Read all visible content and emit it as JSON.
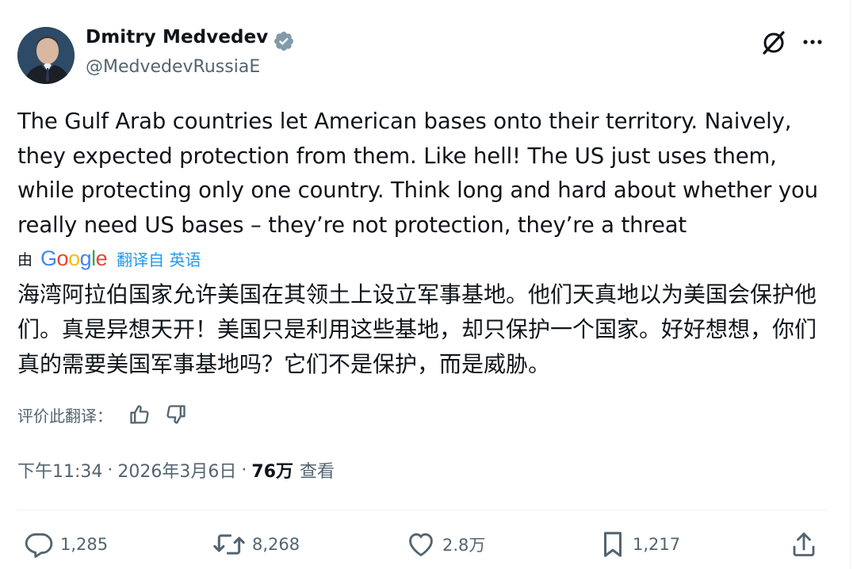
{
  "author": {
    "display_name": "Dmitry Medvedev",
    "handle": "@MedvedevRussiaE",
    "verified_badge": "verified-gear-badge",
    "avatar_icon": "avatar-portrait"
  },
  "header_icons": {
    "grok": "grok-icon",
    "more": "more-dots-icon"
  },
  "tweet": {
    "text": "The Gulf Arab countries let American bases onto their territory. Naively, they expected protection from them. Like hell! The US just uses them, while protecting only one country. Think long and hard about whether you really need US bases – they’re not protection, they’re a threat"
  },
  "translation": {
    "by_label": "由",
    "provider": "Google",
    "link_label": "翻译自 英语",
    "text": "海湾阿拉伯国家允许美国在其领土上设立军事基地。他们天真地以为美国会保护他们。真是异想天开！美国只是利用这些基地，却只保护一个国家。好好想想，你们真的需要美国军事基地吗？它们不是保护，而是威胁。",
    "rate_label": "评价此翻译："
  },
  "meta": {
    "time": "下午11:34",
    "separator": "·",
    "date": "2026年3月6日",
    "views_count": "76万",
    "views_label": "查看"
  },
  "actions": {
    "replies": "1,285",
    "reposts": "8,268",
    "likes": "2.8万",
    "bookmarks": "1,217"
  },
  "colors": {
    "text": "#0f1419",
    "secondary": "#536471",
    "link": "#1d9bf0",
    "badge": "#829aab",
    "google_blue": "#4285f4",
    "google_red": "#ea4335",
    "google_yellow": "#fbbc05",
    "google_green": "#34a853"
  }
}
